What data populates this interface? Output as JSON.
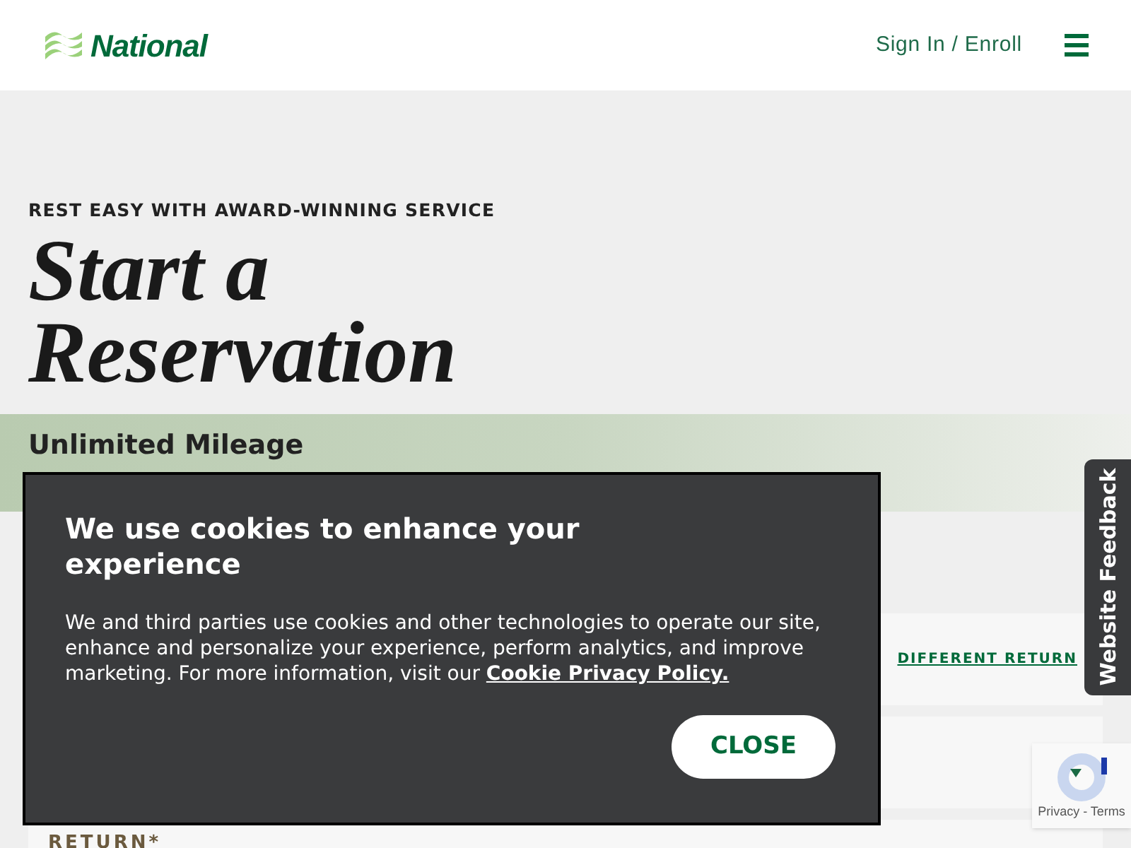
{
  "header": {
    "logo": "National",
    "sign_in": "Sign In / Enroll"
  },
  "hero": {
    "eyebrow": "REST EASY WITH AWARD-WINNING SERVICE",
    "title_lines": [
      "Start a",
      "Reservation"
    ]
  },
  "banner": {
    "title": "Unlimited Mileage"
  },
  "form": {
    "link": "DIFFERENT RETURN",
    "return_label": "RETURN*"
  },
  "feedback_tab": "Website Feedback",
  "recaptcha": {
    "links": "Privacy - Terms"
  },
  "cookie_dialog": {
    "title": "We use cookies to enhance your experience",
    "body": "We and third parties use cookies and other technologies to operate our site, enhance and personalize your experience, perform analytics, and improve marketing. For more information, visit our ",
    "link": "Cookie Privacy Policy.",
    "button": "CLOSE"
  }
}
